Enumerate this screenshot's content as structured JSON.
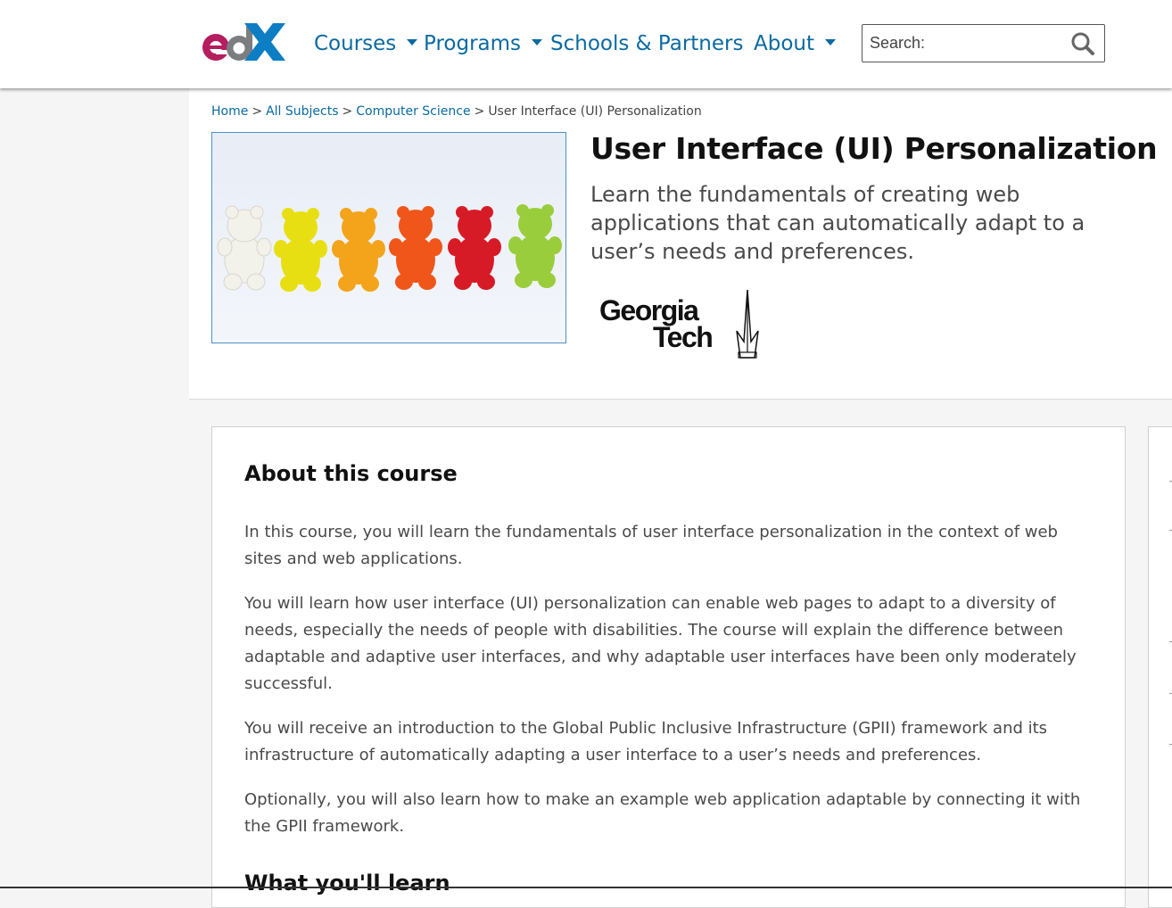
{
  "header": {
    "logo_alt": "edX",
    "nav": [
      {
        "label": "Courses",
        "has_dropdown": true
      },
      {
        "label": "Programs",
        "has_dropdown": true
      },
      {
        "label": "Schools & Partners",
        "has_dropdown": false
      },
      {
        "label": "About",
        "has_dropdown": true
      }
    ],
    "search": {
      "placeholder": "Search:",
      "value": "",
      "icon": "search-icon"
    }
  },
  "breadcrumb": {
    "items": [
      "Home",
      "All Subjects",
      "Computer Science"
    ],
    "current": "User Interface (UI) Personalization",
    "separator": ">"
  },
  "course": {
    "title": "User Interface (UI) Personalization",
    "subtitle": "Learn the fundamentals of creating web applications that can automatically adapt to a user’s needs and preferences.",
    "school_line1": "Georgia",
    "school_line2": "Tech"
  },
  "about": {
    "heading": "About this course",
    "paragraphs": [
      "In this course, you will learn the fundamentals of user interface personalization in the context of web sites and web applications.",
      "You will learn how user interface (UI) personalization can enable web pages to adapt to a diversity of needs, especially the needs of people with disabilities. The course will explain the difference between adaptable and adaptive user interfaces, and why adaptable user interfaces have been only moderately successful.",
      "You will receive an introduction to the Global Public Inclusive Infrastructure (GPII) framework and its infrastructure of automatically adapting a user interface to a user’s needs and preferences.",
      "Optionally, you will also learn how to make an example web application adaptable by connecting it with the GPII framework."
    ],
    "learn_heading": "What you'll learn"
  },
  "colors": {
    "link": "#0a6aa1",
    "brand_magenta": "#b51d5e",
    "brand_blue": "#0d7ec4",
    "text": "#4a4a4a"
  }
}
